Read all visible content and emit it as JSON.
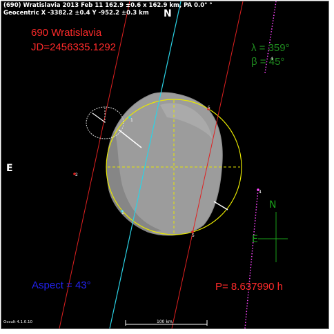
{
  "header": {
    "line1": "(690) Wratislavia  2013 Feb 11   162.9 ±0.6 x 162.9 km, PA 0.0° °",
    "line2": "Geocentric  X  -3382.2 ±0.4  Y -952.2 ±0.3 km"
  },
  "title": {
    "name": "690 Wratislavia",
    "jd": "JD=2456335.1292"
  },
  "orientation": {
    "lambda": "λ = 359°",
    "beta": "β = 45°"
  },
  "compass": {
    "top_north": "N",
    "left_east": "E",
    "rose_north": "N",
    "rose_east": "E"
  },
  "aspect": "Aspect = 43°",
  "period": "P= 8.637990 h",
  "scale_label": "100 km.",
  "software": "Occult 4.1.0.10",
  "chord_labels": [
    "1",
    "5",
    "1",
    "5",
    "2",
    "4",
    "4"
  ],
  "colors": {
    "title_red": "#ff2a2a",
    "lambda_green": "#1f8a1f",
    "aspect_blue": "#2222ee",
    "ellipse_yellow": "#e8e800",
    "chord_cyan": "#2bd3e6",
    "chord_red": "#e02020",
    "chord_magenta": "#ff44ff",
    "rose_green": "#1aa01a"
  },
  "icons": [
    "north-pole-glyph",
    "compass-rose-icon"
  ]
}
